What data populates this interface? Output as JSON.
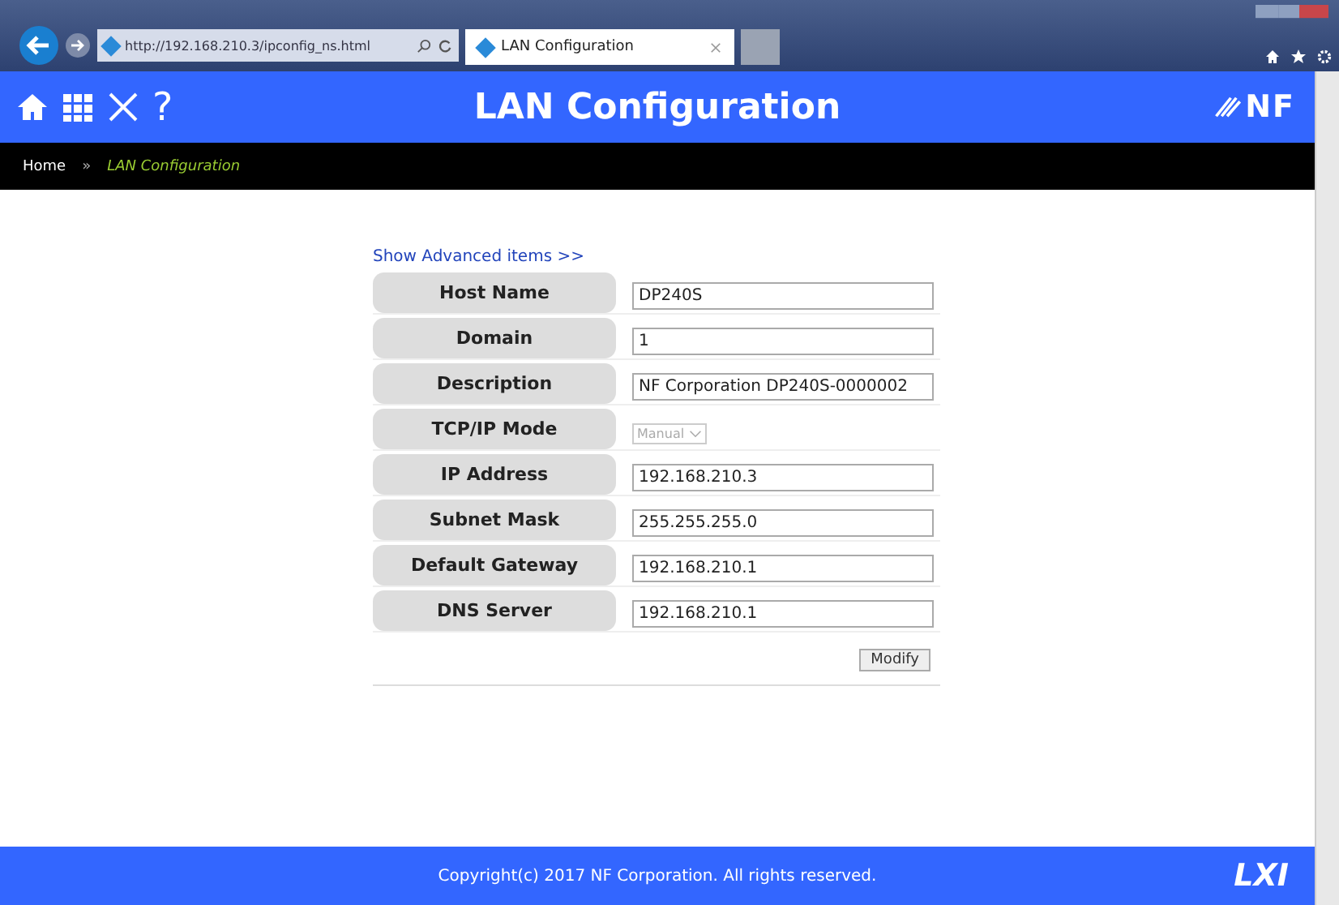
{
  "browser": {
    "address": "http://192.168.210.3/ipconfig_ns.html",
    "tab_title": "LAN Configuration"
  },
  "header": {
    "title": "LAN Configuration",
    "help": "?",
    "logo": "NF"
  },
  "breadcrumb": {
    "home": "Home",
    "separator": "»",
    "current": "LAN Configuration"
  },
  "advanced_link": "Show Advanced items >>",
  "fields": [
    {
      "kind": "text",
      "label": "Host Name",
      "value": "DP240S",
      "disabled": false
    },
    {
      "kind": "text",
      "label": "Domain",
      "value": "1",
      "disabled": false
    },
    {
      "kind": "text",
      "label": "Description",
      "value": "NF Corporation DP240S-0000002",
      "disabled": false
    },
    {
      "kind": "select",
      "label": "TCP/IP Mode",
      "value": "Manual",
      "disabled": true
    },
    {
      "kind": "text",
      "label": "IP Address",
      "value": "192.168.210.3",
      "disabled": false
    },
    {
      "kind": "text",
      "label": "Subnet Mask",
      "value": "255.255.255.0",
      "disabled": false
    },
    {
      "kind": "text",
      "label": "Default Gateway",
      "value": "192.168.210.1",
      "disabled": false
    },
    {
      "kind": "text",
      "label": "DNS Server",
      "value": "192.168.210.1",
      "disabled": false
    }
  ],
  "modify_button": "Modify",
  "footer": {
    "copyright": "Copyright(c) 2017 NF Corporation. All rights reserved.",
    "logo": "LXI"
  }
}
